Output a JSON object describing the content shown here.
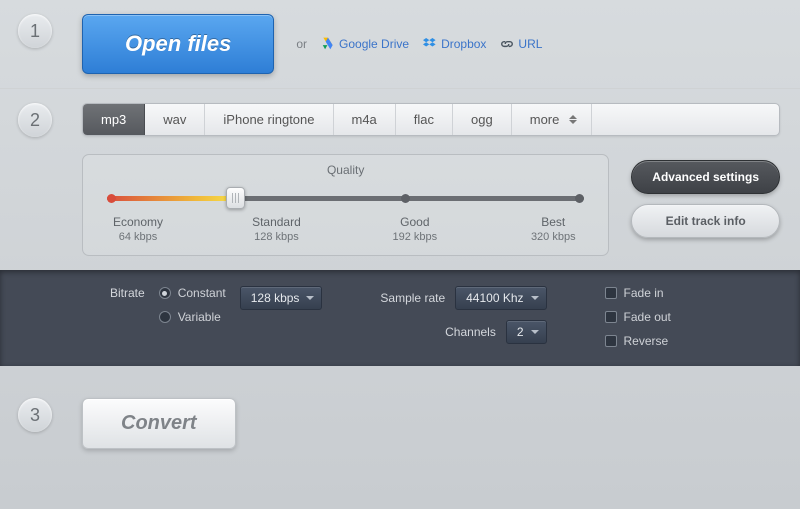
{
  "step_numbers": {
    "s1": "1",
    "s2": "2",
    "s3": "3"
  },
  "open_button": "Open files",
  "sources": {
    "or": "or",
    "gdrive": "Google Drive",
    "dropbox": "Dropbox",
    "url": "URL"
  },
  "formats": [
    "mp3",
    "wav",
    "iPhone ringtone",
    "m4a",
    "flac",
    "ogg",
    "more"
  ],
  "active_format_index": 0,
  "quality": {
    "title": "Quality",
    "stops": [
      {
        "name": "Economy",
        "rate": "64 kbps"
      },
      {
        "name": "Standard",
        "rate": "128 kbps"
      },
      {
        "name": "Good",
        "rate": "192 kbps"
      },
      {
        "name": "Best",
        "rate": "320 kbps"
      }
    ]
  },
  "side": {
    "advanced": "Advanced settings",
    "edit": "Edit track info"
  },
  "adv": {
    "bitrate_label": "Bitrate",
    "bitrate_mode_constant": "Constant",
    "bitrate_mode_variable": "Variable",
    "bitrate_value": "128 kbps",
    "sample_rate_label": "Sample rate",
    "sample_rate_value": "44100 Khz",
    "channels_label": "Channels",
    "channels_value": "2",
    "fade_in": "Fade in",
    "fade_out": "Fade out",
    "reverse": "Reverse"
  },
  "convert_button": "Convert"
}
